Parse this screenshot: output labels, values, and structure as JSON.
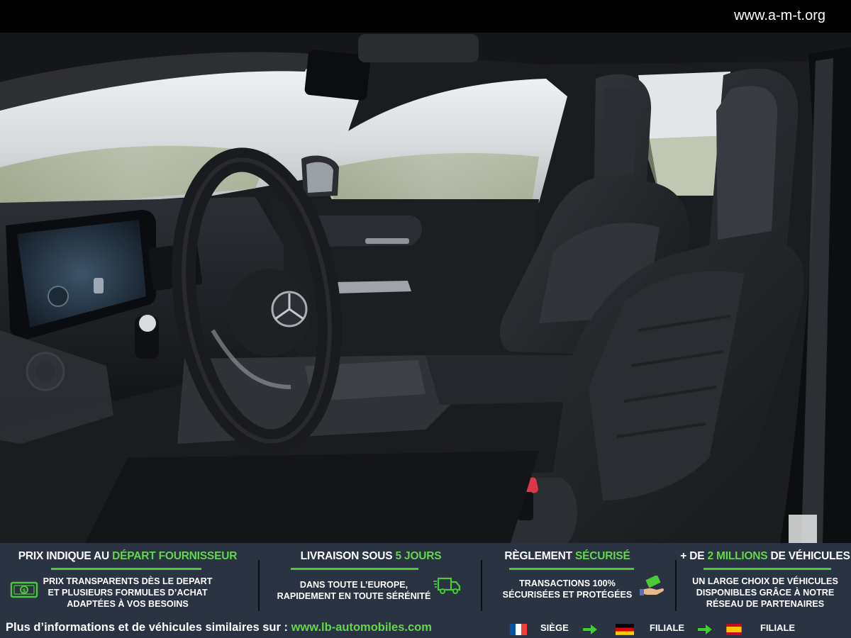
{
  "header": {
    "site_url": "www.a-m-t.org"
  },
  "photo": {
    "subject": "car-interior-photo"
  },
  "features": [
    {
      "title_before": "PRIX INDIQUE AU ",
      "title_highlight": "DÉPART FOURNISSEUR",
      "title_after": "",
      "lines": [
        "PRIX TRANSPARENTS DÈS LE DEPART",
        "ET PLUSIEURS FORMULES D’ACHAT",
        "ADAPTÉES À VOS BESOINS"
      ],
      "icon": "banknote-icon"
    },
    {
      "title_before": "LIVRAISON SOUS ",
      "title_highlight": "5 JOURS",
      "title_after": "",
      "lines": [
        "DANS TOUTE L’EUROPE,",
        "RAPIDEMENT EN TOUTE SÉRÉNITÉ"
      ],
      "icon": "delivery-truck-icon"
    },
    {
      "title_before": "RÈGLEMENT ",
      "title_highlight": "SÉCURISÉ",
      "title_after": "",
      "lines": [
        "TRANSACTIONS 100%",
        "SÉCURISÉES ET PROTÉGÉES"
      ],
      "icon": "payment-hand-icon"
    },
    {
      "title_before": "+ DE ",
      "title_highlight": "2 MILLIONS",
      "title_after": " DE VÉHICULES",
      "lines": [
        "UN LARGE CHOIX DE VÉHICULES",
        "DISPONIBLES GRÂCE À NOTRE",
        "RÉSEAU DE PARTENAIRES"
      ],
      "icon": ""
    }
  ],
  "footer": {
    "text": "Plus d’informations et de véhicules similaires sur :",
    "link": "www.lb-automobiles.com",
    "locations": [
      {
        "flag": "france-flag",
        "label": "SIÈGE"
      },
      {
        "flag": "germany-flag",
        "label": "FILIALE"
      },
      {
        "flag": "spain-flag",
        "label": "FILIALE"
      }
    ]
  },
  "colors": {
    "accent_green": "#63d64c",
    "band_background": "#2a3341"
  }
}
